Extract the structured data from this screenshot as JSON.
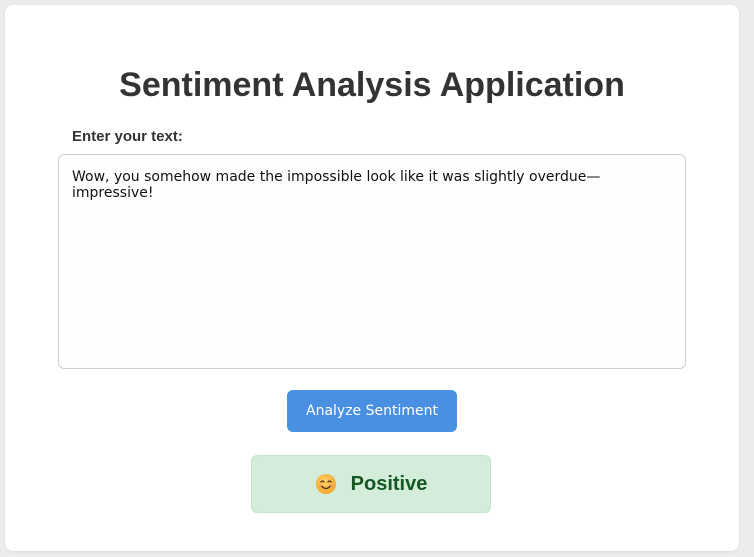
{
  "app": {
    "title": "Sentiment Analysis Application"
  },
  "input": {
    "label": "Enter your text:",
    "value": "Wow, you somehow made the impossible look like it was slightly overdue—impressive!",
    "placeholder": ""
  },
  "actions": {
    "analyze_label": "Analyze Sentiment"
  },
  "result": {
    "icon": "smiling-face-icon",
    "label": "Positive",
    "colors": {
      "background": "#d4edda",
      "border": "#c3e6cb",
      "text": "#155724"
    }
  },
  "theme": {
    "accent": "#4a90e2"
  }
}
